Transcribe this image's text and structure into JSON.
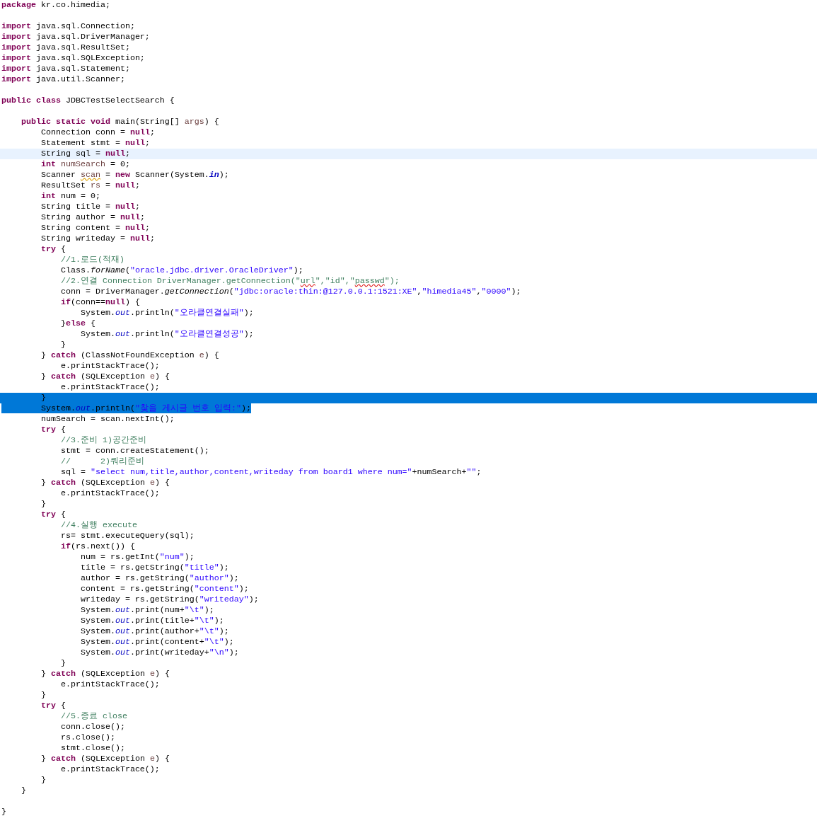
{
  "editor": {
    "lines": [
      {
        "current": false,
        "selected": false,
        "tokens": [
          {
            "kind": "keyword",
            "text": "package"
          },
          {
            "kind": "plain",
            "text": " kr.co.himedia;"
          }
        ]
      },
      {
        "current": false,
        "selected": false
      },
      {
        "current": false,
        "selected": false,
        "tokens": [
          {
            "kind": "keyword",
            "text": "import"
          },
          {
            "kind": "plain",
            "text": " java.sql.Connection;"
          }
        ]
      },
      {
        "current": false,
        "selected": false,
        "tokens": [
          {
            "kind": "keyword",
            "text": "import"
          },
          {
            "kind": "plain",
            "text": " java.sql.DriverManager;"
          }
        ]
      },
      {
        "current": false,
        "selected": false,
        "tokens": [
          {
            "kind": "keyword",
            "text": "import"
          },
          {
            "kind": "plain",
            "text": " java.sql.ResultSet;"
          }
        ]
      },
      {
        "current": false,
        "selected": false,
        "tokens": [
          {
            "kind": "keyword",
            "text": "import"
          },
          {
            "kind": "plain",
            "text": " java.sql.SQLException;"
          }
        ]
      },
      {
        "current": false,
        "selected": false,
        "tokens": [
          {
            "kind": "keyword",
            "text": "import"
          },
          {
            "kind": "plain",
            "text": " java.sql.Statement;"
          }
        ]
      },
      {
        "current": false,
        "selected": false,
        "tokens": [
          {
            "kind": "keyword",
            "text": "import"
          },
          {
            "kind": "plain",
            "text": " java.util.Scanner;"
          }
        ]
      },
      {
        "current": false,
        "selected": false
      },
      {
        "current": false,
        "selected": false,
        "tokens": [
          {
            "kind": "keyword",
            "text": "public class"
          },
          {
            "kind": "plain",
            "text": " JDBCTestSelectSearch {"
          }
        ]
      },
      {
        "current": false,
        "selected": false
      },
      {
        "current": false,
        "selected": false,
        "tokens": [
          {
            "kind": "keyword",
            "text": "\tpublic static void"
          },
          {
            "kind": "plain",
            "text": " main(String[] "
          },
          {
            "kind": "var",
            "text": "args"
          },
          {
            "kind": "plain",
            "text": ") {"
          }
        ]
      },
      {
        "current": false,
        "selected": false,
        "tokens": [
          {
            "kind": "plain",
            "text": "\t\tConnection conn = "
          },
          {
            "kind": "keyword",
            "text": "null"
          },
          {
            "kind": "plain",
            "text": ";"
          }
        ]
      },
      {
        "current": false,
        "selected": false,
        "tokens": [
          {
            "kind": "plain",
            "text": "\t\tStatement stmt = "
          },
          {
            "kind": "keyword",
            "text": "null"
          },
          {
            "kind": "plain",
            "text": ";"
          }
        ]
      },
      {
        "current": true,
        "selected": false,
        "tokens": [
          {
            "kind": "plain",
            "text": "\t\tString sql = "
          },
          {
            "kind": "keyword",
            "text": "null"
          },
          {
            "kind": "plain",
            "text": ";"
          }
        ]
      },
      {
        "current": false,
        "selected": false,
        "tokens": [
          {
            "kind": "keyword",
            "text": "\t\tint"
          },
          {
            "kind": "var",
            "text": " numSearch"
          },
          {
            "kind": "plain",
            "text": " = 0;"
          }
        ]
      },
      {
        "current": false,
        "selected": false,
        "tokens": [
          {
            "kind": "plain",
            "text": "\t\tScanner "
          },
          {
            "kind": "unused",
            "text": "scan"
          },
          {
            "kind": "plain",
            "text": " = "
          },
          {
            "kind": "keyword",
            "text": "new"
          },
          {
            "kind": "plain",
            "text": " Scanner(System."
          },
          {
            "kind": "constant",
            "text": "in"
          },
          {
            "kind": "plain",
            "text": ");"
          }
        ]
      },
      {
        "current": false,
        "selected": false,
        "tokens": [
          {
            "kind": "plain",
            "text": "\t\tResultSet "
          },
          {
            "kind": "var",
            "text": "rs"
          },
          {
            "kind": "plain",
            "text": " = "
          },
          {
            "kind": "keyword",
            "text": "null"
          },
          {
            "kind": "plain",
            "text": ";"
          }
        ]
      },
      {
        "current": false,
        "selected": false,
        "tokens": [
          {
            "kind": "keyword",
            "text": "\t\tint"
          },
          {
            "kind": "plain",
            "text": " num = 0;"
          }
        ]
      },
      {
        "current": false,
        "selected": false,
        "tokens": [
          {
            "kind": "plain",
            "text": "\t\tString title = "
          },
          {
            "kind": "keyword",
            "text": "null"
          },
          {
            "kind": "plain",
            "text": ";"
          }
        ]
      },
      {
        "current": false,
        "selected": false,
        "tokens": [
          {
            "kind": "plain",
            "text": "\t\tString author = "
          },
          {
            "kind": "keyword",
            "text": "null"
          },
          {
            "kind": "plain",
            "text": ";"
          }
        ]
      },
      {
        "current": false,
        "selected": false,
        "tokens": [
          {
            "kind": "plain",
            "text": "\t\tString content = "
          },
          {
            "kind": "keyword",
            "text": "null"
          },
          {
            "kind": "plain",
            "text": ";"
          }
        ]
      },
      {
        "current": false,
        "selected": false,
        "tokens": [
          {
            "kind": "plain",
            "text": "\t\tString writeday = "
          },
          {
            "kind": "keyword",
            "text": "null"
          },
          {
            "kind": "plain",
            "text": ";"
          }
        ]
      },
      {
        "current": false,
        "selected": false,
        "tokens": [
          {
            "kind": "keyword",
            "text": "\t\ttry"
          },
          {
            "kind": "plain",
            "text": " {"
          }
        ]
      },
      {
        "current": false,
        "selected": false,
        "tokens": [
          {
            "kind": "comment",
            "text": "\t\t\t//1.로드(적재)"
          }
        ]
      },
      {
        "current": false,
        "selected": false,
        "tokens": [
          {
            "kind": "plain",
            "text": "\t\t\tClass."
          },
          {
            "kind": "static",
            "text": "forName"
          },
          {
            "kind": "plain",
            "text": "("
          },
          {
            "kind": "string",
            "text": "\"oracle.jdbc.driver.OracleDriver\""
          },
          {
            "kind": "plain",
            "text": ");"
          }
        ]
      },
      {
        "current": false,
        "selected": false,
        "tokens": [
          {
            "kind": "comment",
            "text": "\t\t\t//2.연결 Connection DriverManager.getConnection(\""
          },
          {
            "kind": "misspelled",
            "text": "url"
          },
          {
            "kind": "comment",
            "text": "\",\"id\",\""
          },
          {
            "kind": "misspelled",
            "text": "passwd"
          },
          {
            "kind": "comment",
            "text": "\");"
          }
        ]
      },
      {
        "current": false,
        "selected": false,
        "tokens": [
          {
            "kind": "plain",
            "text": "\t\t\tconn = DriverManager."
          },
          {
            "kind": "static",
            "text": "getConnection"
          },
          {
            "kind": "plain",
            "text": "("
          },
          {
            "kind": "string",
            "text": "\"jdbc:oracle:thin:@127.0.0.1:1521:XE\""
          },
          {
            "kind": "plain",
            "text": ","
          },
          {
            "kind": "string",
            "text": "\"himedia45\""
          },
          {
            "kind": "plain",
            "text": ","
          },
          {
            "kind": "string",
            "text": "\"0000\""
          },
          {
            "kind": "plain",
            "text": ");"
          }
        ]
      },
      {
        "current": false,
        "selected": false,
        "tokens": [
          {
            "kind": "keyword",
            "text": "\t\t\tif"
          },
          {
            "kind": "plain",
            "text": "(conn=="
          },
          {
            "kind": "keyword",
            "text": "null"
          },
          {
            "kind": "plain",
            "text": ") {"
          }
        ]
      },
      {
        "current": false,
        "selected": false,
        "tokens": [
          {
            "kind": "plain",
            "text": "\t\t\t\tSystem."
          },
          {
            "kind": "field",
            "text": "out"
          },
          {
            "kind": "plain",
            "text": ".println("
          },
          {
            "kind": "string",
            "text": "\"오라클연결실패\""
          },
          {
            "kind": "plain",
            "text": ");"
          }
        ]
      },
      {
        "current": false,
        "selected": false,
        "tokens": [
          {
            "kind": "plain",
            "text": "\t\t\t}"
          },
          {
            "kind": "keyword",
            "text": "else"
          },
          {
            "kind": "plain",
            "text": " {"
          }
        ]
      },
      {
        "current": false,
        "selected": false,
        "tokens": [
          {
            "kind": "plain",
            "text": "\t\t\t\tSystem."
          },
          {
            "kind": "field",
            "text": "out"
          },
          {
            "kind": "plain",
            "text": ".println("
          },
          {
            "kind": "string",
            "text": "\"오라클연결성공\""
          },
          {
            "kind": "plain",
            "text": ");"
          }
        ]
      },
      {
        "current": false,
        "selected": false,
        "tokens": [
          {
            "kind": "plain",
            "text": "\t\t\t}"
          }
        ]
      },
      {
        "current": false,
        "selected": false,
        "tokens": [
          {
            "kind": "plain",
            "text": "\t\t} "
          },
          {
            "kind": "keyword",
            "text": "catch"
          },
          {
            "kind": "plain",
            "text": " (ClassNotFoundException "
          },
          {
            "kind": "var",
            "text": "e"
          },
          {
            "kind": "plain",
            "text": ") {"
          }
        ]
      },
      {
        "current": false,
        "selected": false,
        "tokens": [
          {
            "kind": "plain",
            "text": "\t\t\te.printStackTrace();"
          }
        ]
      },
      {
        "current": false,
        "selected": false,
        "tokens": [
          {
            "kind": "plain",
            "text": "\t\t} "
          },
          {
            "kind": "keyword",
            "text": "catch"
          },
          {
            "kind": "plain",
            "text": " (SQLException "
          },
          {
            "kind": "var",
            "text": "e"
          },
          {
            "kind": "plain",
            "text": ") {"
          }
        ]
      },
      {
        "current": false,
        "selected": false,
        "tokens": [
          {
            "kind": "plain",
            "text": "\t\t\te.printStackTrace();"
          }
        ]
      },
      {
        "current": false,
        "selected": true,
        "tokens": [
          {
            "kind": "plain",
            "text": "\t\t}"
          }
        ]
      },
      {
        "current": false,
        "selected": true,
        "tokens": [
          {
            "kind": "plain",
            "text": "\t\tSystem."
          },
          {
            "kind": "field",
            "text": "out"
          },
          {
            "kind": "plain",
            "text": ".println("
          },
          {
            "kind": "string",
            "text": "\"찾을 게시글 번호 입력:\""
          },
          {
            "kind": "plain",
            "text": ");"
          }
        ]
      },
      {
        "current": false,
        "selected": false,
        "tokens": [
          {
            "kind": "plain",
            "text": "\t\tnumSearch = scan.nextInt();"
          }
        ]
      },
      {
        "current": false,
        "selected": false,
        "tokens": [
          {
            "kind": "keyword",
            "text": "\t\ttry"
          },
          {
            "kind": "plain",
            "text": " {"
          }
        ]
      },
      {
        "current": false,
        "selected": false,
        "tokens": [
          {
            "kind": "comment",
            "text": "\t\t\t//3.준비 1)공간준비"
          }
        ]
      },
      {
        "current": false,
        "selected": false,
        "tokens": [
          {
            "kind": "plain",
            "text": "\t\t\tstmt = conn.createStatement();"
          }
        ]
      },
      {
        "current": false,
        "selected": false,
        "tokens": [
          {
            "kind": "comment",
            "text": "\t\t\t//      2)쿼리준비"
          }
        ]
      },
      {
        "current": false,
        "selected": false,
        "tokens": [
          {
            "kind": "plain",
            "text": "\t\t\tsql = "
          },
          {
            "kind": "string",
            "text": "\"select num,title,author,content,writeday from board1 where num=\""
          },
          {
            "kind": "plain",
            "text": "+numSearch+"
          },
          {
            "kind": "string",
            "text": "\"\""
          },
          {
            "kind": "plain",
            "text": ";"
          }
        ]
      },
      {
        "current": false,
        "selected": false,
        "tokens": [
          {
            "kind": "plain",
            "text": "\t\t} "
          },
          {
            "kind": "keyword",
            "text": "catch"
          },
          {
            "kind": "plain",
            "text": " (SQLException "
          },
          {
            "kind": "var",
            "text": "e"
          },
          {
            "kind": "plain",
            "text": ") {"
          }
        ]
      },
      {
        "current": false,
        "selected": false,
        "tokens": [
          {
            "kind": "plain",
            "text": "\t\t\te.printStackTrace();"
          }
        ]
      },
      {
        "current": false,
        "selected": false,
        "tokens": [
          {
            "kind": "plain",
            "text": "\t\t}"
          }
        ]
      },
      {
        "current": false,
        "selected": false,
        "tokens": [
          {
            "kind": "keyword",
            "text": "\t\ttry"
          },
          {
            "kind": "plain",
            "text": " {"
          }
        ]
      },
      {
        "current": false,
        "selected": false,
        "tokens": [
          {
            "kind": "comment",
            "text": "\t\t\t//4.실행 execute"
          }
        ]
      },
      {
        "current": false,
        "selected": false,
        "tokens": [
          {
            "kind": "plain",
            "text": "\t\t\trs= stmt.executeQuery(sql);"
          }
        ]
      },
      {
        "current": false,
        "selected": false,
        "tokens": [
          {
            "kind": "keyword",
            "text": "\t\t\tif"
          },
          {
            "kind": "plain",
            "text": "(rs.next()) {"
          }
        ]
      },
      {
        "current": false,
        "selected": false,
        "tokens": [
          {
            "kind": "plain",
            "text": "\t\t\t\tnum = rs.getInt("
          },
          {
            "kind": "string",
            "text": "\"num\""
          },
          {
            "kind": "plain",
            "text": ");"
          }
        ]
      },
      {
        "current": false,
        "selected": false,
        "tokens": [
          {
            "kind": "plain",
            "text": "\t\t\t\ttitle = rs.getString("
          },
          {
            "kind": "string",
            "text": "\"title\""
          },
          {
            "kind": "plain",
            "text": ");"
          }
        ]
      },
      {
        "current": false,
        "selected": false,
        "tokens": [
          {
            "kind": "plain",
            "text": "\t\t\t\tauthor = rs.getString("
          },
          {
            "kind": "string",
            "text": "\"author\""
          },
          {
            "kind": "plain",
            "text": ");"
          }
        ]
      },
      {
        "current": false,
        "selected": false,
        "tokens": [
          {
            "kind": "plain",
            "text": "\t\t\t\tcontent = rs.getString("
          },
          {
            "kind": "string",
            "text": "\"content\""
          },
          {
            "kind": "plain",
            "text": ");"
          }
        ]
      },
      {
        "current": false,
        "selected": false,
        "tokens": [
          {
            "kind": "plain",
            "text": "\t\t\t\twriteday = rs.getString("
          },
          {
            "kind": "string",
            "text": "\"writeday\""
          },
          {
            "kind": "plain",
            "text": ");"
          }
        ]
      },
      {
        "current": false,
        "selected": false,
        "tokens": [
          {
            "kind": "plain",
            "text": "\t\t\t\tSystem."
          },
          {
            "kind": "field",
            "text": "out"
          },
          {
            "kind": "plain",
            "text": ".print(num+"
          },
          {
            "kind": "string",
            "text": "\"\\t\""
          },
          {
            "kind": "plain",
            "text": ");"
          }
        ]
      },
      {
        "current": false,
        "selected": false,
        "tokens": [
          {
            "kind": "plain",
            "text": "\t\t\t\tSystem."
          },
          {
            "kind": "field",
            "text": "out"
          },
          {
            "kind": "plain",
            "text": ".print(title+"
          },
          {
            "kind": "string",
            "text": "\"\\t\""
          },
          {
            "kind": "plain",
            "text": ");"
          }
        ]
      },
      {
        "current": false,
        "selected": false,
        "tokens": [
          {
            "kind": "plain",
            "text": "\t\t\t\tSystem."
          },
          {
            "kind": "field",
            "text": "out"
          },
          {
            "kind": "plain",
            "text": ".print(author+"
          },
          {
            "kind": "string",
            "text": "\"\\t\""
          },
          {
            "kind": "plain",
            "text": ");"
          }
        ]
      },
      {
        "current": false,
        "selected": false,
        "tokens": [
          {
            "kind": "plain",
            "text": "\t\t\t\tSystem."
          },
          {
            "kind": "field",
            "text": "out"
          },
          {
            "kind": "plain",
            "text": ".print(content+"
          },
          {
            "kind": "string",
            "text": "\"\\t\""
          },
          {
            "kind": "plain",
            "text": ");"
          }
        ]
      },
      {
        "current": false,
        "selected": false,
        "tokens": [
          {
            "kind": "plain",
            "text": "\t\t\t\tSystem."
          },
          {
            "kind": "field",
            "text": "out"
          },
          {
            "kind": "plain",
            "text": ".print(writeday+"
          },
          {
            "kind": "string",
            "text": "\"\\n\""
          },
          {
            "kind": "plain",
            "text": ");"
          }
        ]
      },
      {
        "current": false,
        "selected": false,
        "tokens": [
          {
            "kind": "plain",
            "text": "\t\t\t}"
          }
        ]
      },
      {
        "current": false,
        "selected": false,
        "tokens": [
          {
            "kind": "plain",
            "text": "\t\t} "
          },
          {
            "kind": "keyword",
            "text": "catch"
          },
          {
            "kind": "plain",
            "text": " (SQLException "
          },
          {
            "kind": "var",
            "text": "e"
          },
          {
            "kind": "plain",
            "text": ") {"
          }
        ]
      },
      {
        "current": false,
        "selected": false,
        "tokens": [
          {
            "kind": "plain",
            "text": "\t\t\te.printStackTrace();"
          }
        ]
      },
      {
        "current": false,
        "selected": false,
        "tokens": [
          {
            "kind": "plain",
            "text": "\t\t}"
          }
        ]
      },
      {
        "current": false,
        "selected": false,
        "tokens": [
          {
            "kind": "keyword",
            "text": "\t\ttry"
          },
          {
            "kind": "plain",
            "text": " {"
          }
        ]
      },
      {
        "current": false,
        "selected": false,
        "tokens": [
          {
            "kind": "comment",
            "text": "\t\t\t//5.종료 close"
          }
        ]
      },
      {
        "current": false,
        "selected": false,
        "tokens": [
          {
            "kind": "plain",
            "text": "\t\t\tconn.close();"
          }
        ]
      },
      {
        "current": false,
        "selected": false,
        "tokens": [
          {
            "kind": "plain",
            "text": "\t\t\trs.close();"
          }
        ]
      },
      {
        "current": false,
        "selected": false,
        "tokens": [
          {
            "kind": "plain",
            "text": "\t\t\tstmt.close();"
          }
        ]
      },
      {
        "current": false,
        "selected": false,
        "tokens": [
          {
            "kind": "plain",
            "text": "\t\t} "
          },
          {
            "kind": "keyword",
            "text": "catch"
          },
          {
            "kind": "plain",
            "text": " (SQLException "
          },
          {
            "kind": "var",
            "text": "e"
          },
          {
            "kind": "plain",
            "text": ") {"
          }
        ]
      },
      {
        "current": false,
        "selected": false,
        "tokens": [
          {
            "kind": "plain",
            "text": "\t\t\te.printStackTrace();"
          }
        ]
      },
      {
        "current": false,
        "selected": false,
        "tokens": [
          {
            "kind": "plain",
            "text": "\t\t}"
          }
        ]
      },
      {
        "current": false,
        "selected": false,
        "tokens": [
          {
            "kind": "plain",
            "text": "\t}"
          }
        ]
      },
      {
        "current": false,
        "selected": false
      },
      {
        "current": false,
        "selected": false,
        "tokens": [
          {
            "kind": "plain",
            "text": "}"
          }
        ]
      }
    ]
  }
}
